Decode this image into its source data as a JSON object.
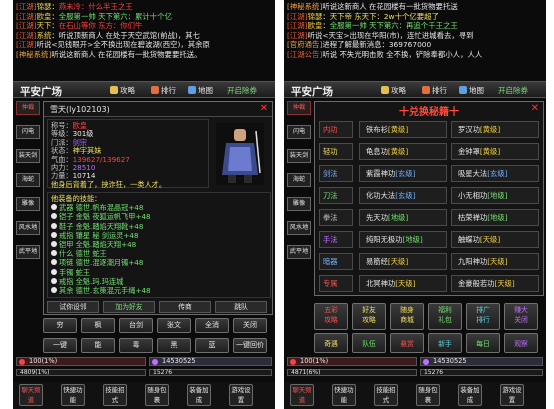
{
  "left": {
    "chat": [
      {
        "tag": "[江湖]",
        "name": "锦瑟",
        "text": "燕未冷：什么半王之王",
        "color": "red"
      },
      {
        "tag": "[江湖]",
        "name": "欧皇",
        "text": "全服第一帅 天下第六：累计十个亿",
        "color": "green"
      },
      {
        "tag": "[江湖]",
        "name": "天下",
        "text": "在石山等你 东方：你们牛",
        "color": "red"
      },
      {
        "tag": "[江湖]",
        "name": "系统",
        "text": "听说顶新商人 在处于天空武馆(前战)，其七",
        "color": "white"
      },
      {
        "tag": "[江湖]",
        "name": "",
        "text": "听说<见钱眼开>全不换出现在碧波湖(西空)，其余原",
        "color": "white"
      },
      {
        "tag": "[神秘系统]",
        "name": "",
        "text": "听说这新商人 在花园楼有一批货物要要托送。",
        "color": "white"
      }
    ],
    "topbar": {
      "place": "平安广场",
      "attack": "攻略",
      "rank": "排行",
      "map": "地图",
      "hangup": "开启除券"
    },
    "sidebar": [
      "仲裁",
      "闪电",
      "装天剑",
      "海蛇",
      "雕像",
      "风水地",
      "武平地"
    ],
    "player": {
      "name": "雪天(ly102103)",
      "fields": [
        {
          "k": "称号：",
          "v": "欧皇",
          "c": "red"
        },
        {
          "k": "等级：",
          "v": "301级",
          "c": "v"
        },
        {
          "k": "门派：",
          "v": "剑宗",
          "c": "violet"
        },
        {
          "k": "状态：",
          "v": "神宇其妹",
          "c": "yellow"
        },
        {
          "k": "气血：",
          "v": "139627/139627",
          "c": "red"
        },
        {
          "k": "内力：",
          "v": "28510",
          "c": "violet"
        },
        {
          "k": "力量：",
          "v": "10714",
          "c": "v"
        }
      ],
      "note": "他身后背着了，挟诈狂，一类人才。"
    },
    "skills": [
      {
        "n": "他装备的技能：",
        "c": "y",
        "lv": ""
      },
      {
        "n": "武器 德世.帆布混晶冠",
        "c": "",
        "lv": "+48"
      },
      {
        "n": "铠子 金魁 夜狐运帆飞甲",
        "c": "",
        "lv": "+48"
      },
      {
        "n": "鞋子 金魁.踏焰天翔靴",
        "c": "",
        "lv": "+48"
      },
      {
        "n": "戒指 镶星 秘 剑运灵",
        "c": "",
        "lv": "+48"
      },
      {
        "n": "铠甲 全魁.踏焰天翔",
        "c": "",
        "lv": "+48"
      },
      {
        "n": "什么 德世 蛇王",
        "c": "",
        "lv": ""
      },
      {
        "n": "项链 德世.混逐潮月镯",
        "c": "",
        "lv": "+48"
      },
      {
        "n": "手镯 蛇王",
        "c": "",
        "lv": ""
      },
      {
        "n": "戒指 全魁.玛.玛连城",
        "c": "",
        "lv": ""
      },
      {
        "n": "其余 德世.玄策混元手绳",
        "c": "",
        "lv": "+48"
      }
    ],
    "actions": [
      "试你设邻",
      "加为好友",
      "传商",
      "跳队"
    ],
    "row1": [
      "穷",
      "枫",
      "台剑",
      "张文",
      "全消",
      "关闭"
    ],
    "row2": [
      "一键",
      "能",
      "毒",
      "黑",
      "蓝",
      "一键回价"
    ],
    "bars": {
      "hp": "100(1%)",
      "mp": "14530525",
      "exp1": "4809(1%)",
      "exp2": "15276"
    },
    "bottom": [
      "聊天频道",
      "快捷功能",
      "技能招式",
      "随身包裹",
      "装备加成",
      "游戏设置"
    ]
  },
  "right": {
    "chat": [
      {
        "tag": "[神秘系统]",
        "name": "",
        "text": "听说这新商人 在花园楼有一批货物要托送",
        "color": "white"
      },
      {
        "tag": "[江湖]",
        "name": "锦瑟",
        "text": "天下帝 东天下：2w十个亿要超了",
        "color": "yellow"
      },
      {
        "tag": "[江湖]",
        "name": "欧皇",
        "text": "全服第一帅 天下第六：再追个千王之王",
        "color": "green"
      },
      {
        "tag": "[江湖]",
        "name": "",
        "text": "听说<天宝>出现在华阳(市)，连忙进城看去，寻到",
        "color": "white"
      },
      {
        "tag": "[官府通告]",
        "name": "",
        "text": "进程了解最新消息：369767000",
        "color": "white"
      },
      {
        "tag": "[江湖公告]",
        "name": "",
        "text": "听说 不失光明击败 全不换，铲除奉都小人，人人",
        "color": "white"
      }
    ],
    "topbar": {
      "place": "平安广场",
      "attack": "攻略",
      "rank": "排行",
      "map": "地图",
      "hangup": "开启除券"
    },
    "sidebar": [
      "仲裁",
      "闪电",
      "装天剑",
      "海蛇",
      "雕像",
      "风水地",
      "武平地"
    ],
    "grid_title": "十兑换秘籍十",
    "grid_side": [
      {
        "t": "内功",
        "c": ""
      },
      {
        "t": "轻功",
        "c": "y"
      },
      {
        "t": "剑法",
        "c": "b"
      },
      {
        "t": "刀法",
        "c": "g"
      },
      {
        "t": "拳法",
        "c": "gr"
      },
      {
        "t": "手法",
        "c": "p"
      },
      {
        "t": "暗器",
        "c": "b"
      },
      {
        "t": "专属",
        "c": ""
      }
    ],
    "grid": [
      [
        {
          "n": "铁布衫",
          "q": "[黄级]",
          "c": ""
        },
        {
          "n": "罗汉功",
          "q": "[黄级]",
          "c": ""
        }
      ],
      [
        {
          "n": "龟息功",
          "q": "[黄级]",
          "c": ""
        },
        {
          "n": "金钟罩",
          "q": "[黄级]",
          "c": ""
        }
      ],
      [
        {
          "n": "紫霞神功",
          "q": "[玄级]",
          "c": "blue"
        },
        {
          "n": "吸星大法",
          "q": "[玄级]",
          "c": "blue"
        }
      ],
      [
        {
          "n": "化功大法",
          "q": "[玄级]",
          "c": "blue"
        },
        {
          "n": "小无相功",
          "q": "[地级]",
          "c": "green"
        }
      ],
      [
        {
          "n": "先天功",
          "q": "[地级]",
          "c": "green"
        },
        {
          "n": "枯荣禅功",
          "q": "[地级]",
          "c": "green"
        }
      ],
      [
        {
          "n": "纯阳无极功",
          "q": "[地级]",
          "c": "green"
        },
        {
          "n": "触蝶功",
          "q": "[天级]",
          "c": ""
        }
      ],
      [
        {
          "n": "易筋经",
          "q": "[天级]",
          "c": ""
        },
        {
          "n": "九阳神功",
          "q": "[天级]",
          "c": ""
        }
      ],
      [
        {
          "n": "北冥神功",
          "q": "[天级]",
          "c": ""
        },
        {
          "n": "金豪般若功",
          "q": "[天级]",
          "c": ""
        }
      ]
    ],
    "row1": [
      "五彩",
      "好友",
      "随身",
      "福利",
      "排广",
      "赚大"
    ],
    "row1b": [
      "攻略",
      "攻略",
      "商城",
      "礼包",
      "排行",
      "关闭"
    ],
    "row2": [
      "奇遇",
      "队伍",
      "悬赏",
      "新手",
      "每日",
      "观察"
    ],
    "bars": {
      "hp": "100(1%)",
      "mp": "14530525",
      "exp1": "4871(6%)",
      "exp2": "15276"
    },
    "bottom": [
      "聊天频道",
      "快捷功能",
      "技能招式",
      "随身包裹",
      "装备加成",
      "游戏设置"
    ]
  }
}
